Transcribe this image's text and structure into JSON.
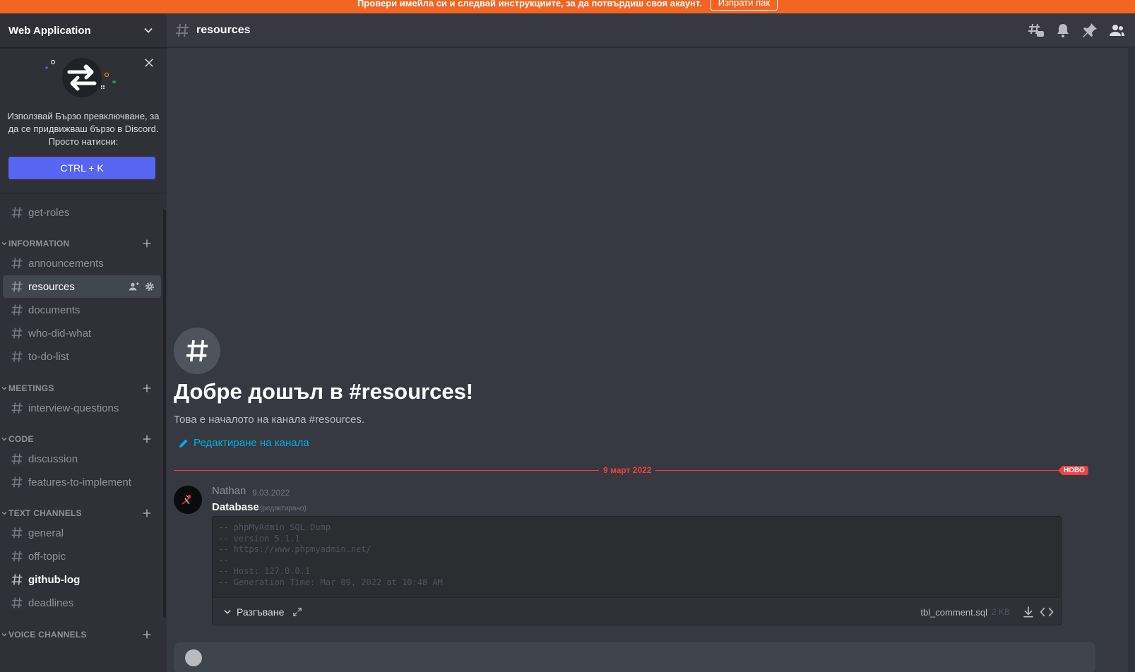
{
  "banner": {
    "text": "Провери имейла си и следвай инструкциите, за да потвърдиш своя акаунт.",
    "button": "Изпрати пак"
  },
  "server": {
    "name": "Web Application"
  },
  "quick_switcher": {
    "text": "Използвай Бързо превключване, за да се придвижваш бързо в Discord. Просто натисни:",
    "shortcut": "CTRL + K"
  },
  "sidebar": {
    "top_channel": "get-roles",
    "categories": [
      {
        "name": "INFORMATION",
        "channels": [
          "announcements",
          "resources",
          "documents",
          "who-did-what",
          "to-do-list"
        ]
      },
      {
        "name": "MEETINGS",
        "channels": [
          "interview-questions"
        ]
      },
      {
        "name": "CODE",
        "channels": [
          "discussion",
          "features-to-implement"
        ]
      },
      {
        "name": "TEXT CHANNELS",
        "channels": [
          "general",
          "off-topic",
          "github-log",
          "deadlines"
        ]
      },
      {
        "name": "VOICE CHANNELS",
        "channels": []
      }
    ],
    "active_channel": "resources",
    "unread_channel": "github-log"
  },
  "channel": {
    "name": "resources",
    "welcome_title": "Добре дошъл в #resources!",
    "welcome_sub": "Това е началото на канала #resources.",
    "edit_link": "Редактиране на канала"
  },
  "divider": {
    "date": "9 март 2022",
    "badge": "НОВО"
  },
  "message": {
    "author": "Nathan",
    "timestamp": "9.03.2022",
    "title": "Database",
    "edited": "(редактирано)",
    "code": "-- phpMyAdmin SQL Dump\n-- version 5.1.1\n-- https://www.phpmyadmin.net/\n--\n-- Host: 127.0.0.1\n-- Generation Time: Mar 09, 2022 at 10:48 AM",
    "expand_label": "Разгъване",
    "file_name": "tbl_comment.sql",
    "file_size": "2 KB"
  },
  "colors": {
    "accent": "#5865f2",
    "banner": "#f26522",
    "new_red": "#ed4245",
    "link": "#00aff4"
  },
  "icons": [
    "chevron-down-icon",
    "close-icon",
    "hash-icon",
    "threads-icon",
    "bell-icon",
    "pin-icon",
    "members-icon",
    "add-member-icon",
    "gear-icon",
    "plus-icon",
    "pencil-icon",
    "expand-icon",
    "download-icon",
    "code-icon"
  ]
}
